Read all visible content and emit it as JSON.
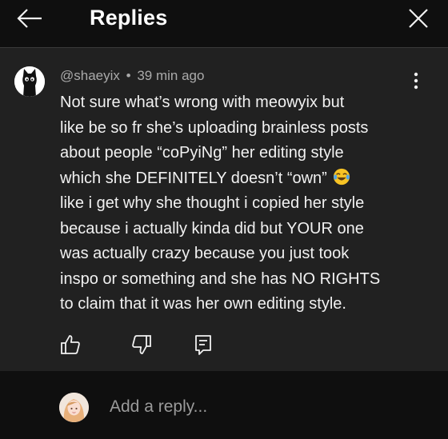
{
  "header": {
    "title": "Replies",
    "back_icon": "arrow-left-icon",
    "close_icon": "close-icon"
  },
  "comment": {
    "author": "@shaeyix",
    "separator": "•",
    "time": "39 min ago",
    "lines": [
      "Not sure what’s wrong with meowyix but",
      "like be so fr she’s uploading brainless posts",
      "about people “coPyiNg” her editing style",
      "which she DEFINITELY doesn’t “own”",
      "like i get why she thought i copied her style",
      "because i actually kinda did but YOUR one",
      "was actually crazy because you just took",
      "inspo or something and she has NO RIGHTS",
      "to claim that it was her own editing style."
    ],
    "emoji": "face-with-tears-of-joy-emoji",
    "actions": [
      "thumbs-up-icon",
      "thumbs-down-icon",
      "reply-icon"
    ]
  },
  "reply_box": {
    "placeholder": "Add a reply..."
  },
  "colors": {
    "background": "#0f0f0f",
    "card": "#212121",
    "text": "#f1f1f1",
    "muted": "#aaaaaa"
  }
}
